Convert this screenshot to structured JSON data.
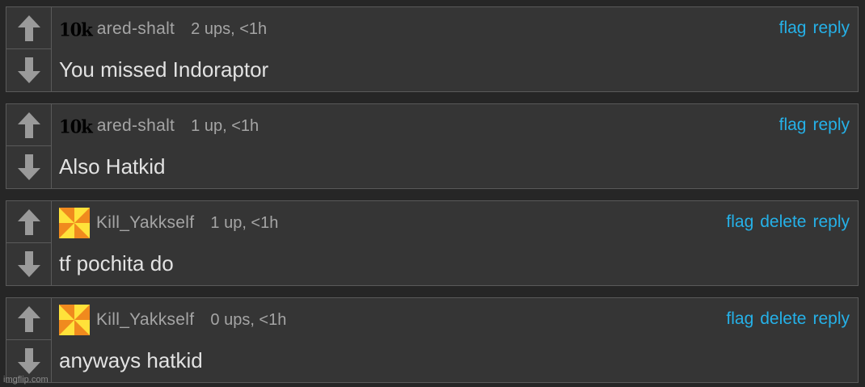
{
  "comments": [
    {
      "badge": "10k",
      "username": "ared-shalt",
      "points": "2 ups, <1h",
      "text": "You missed Indoraptor",
      "actions": [
        "flag",
        "reply"
      ]
    },
    {
      "badge": "10k",
      "username": "ared-shalt",
      "points": "1 up, <1h",
      "text": "Also Hatkid",
      "actions": [
        "flag",
        "reply"
      ]
    },
    {
      "username": "Kill_Yakkself",
      "points": "1 up, <1h",
      "text": "tf pochita do",
      "actions": [
        "flag",
        "delete",
        "reply"
      ]
    },
    {
      "username": "Kill_Yakkself",
      "points": "0 ups, <1h",
      "text": "anyways hatkid",
      "actions": [
        "flag",
        "delete",
        "reply"
      ]
    }
  ],
  "watermark": "imgflip.com",
  "colors": {
    "link": "#25b1e8",
    "panel": "#353535",
    "text": "#e2e2e2",
    "meta": "#a5a5a5",
    "avatar_orange": "#f08a1e",
    "avatar_yellow": "#ffe23a"
  }
}
